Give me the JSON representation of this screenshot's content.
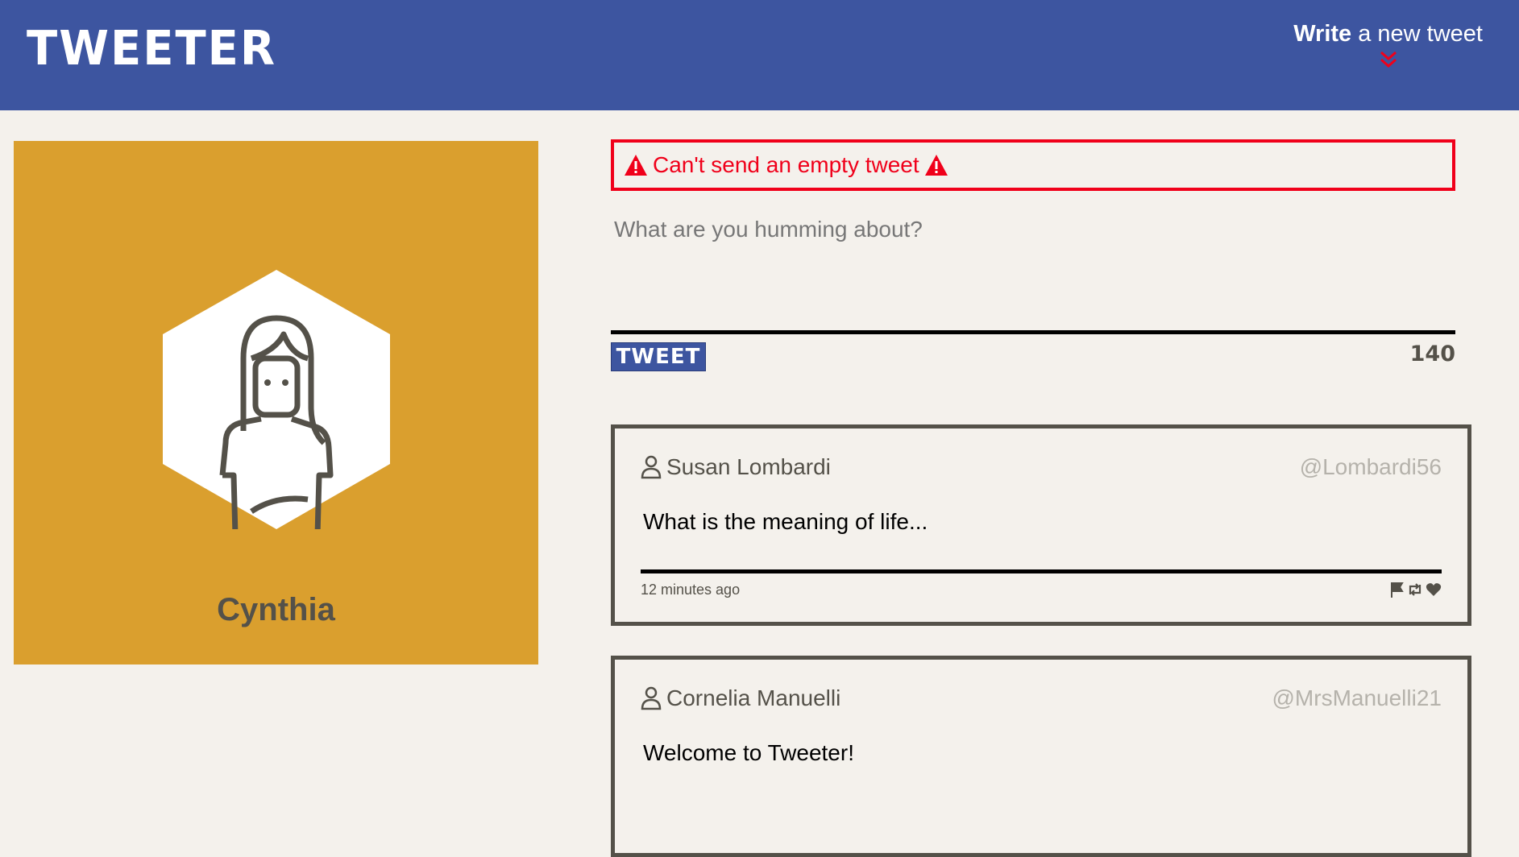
{
  "header": {
    "logo": "TWEETER",
    "write_bold": "Write",
    "write_rest": " a new tweet"
  },
  "profile": {
    "name": "Cynthia"
  },
  "composer": {
    "error": "Can't send an empty tweet",
    "placeholder": "What are you humming about?",
    "button": "TWEET",
    "counter": "140"
  },
  "tweets": [
    {
      "name": "Susan Lombardi",
      "handle": "@Lombardi56",
      "text": "What is the meaning of life...",
      "time": "12 minutes ago"
    },
    {
      "name": "Cornelia Manuelli",
      "handle": "@MrsManuelli21",
      "text": "Welcome to Tweeter!"
    }
  ],
  "colors": {
    "brand": "#3d55a0",
    "error": "#f0001a",
    "profile_bg": "#da9f2e"
  }
}
